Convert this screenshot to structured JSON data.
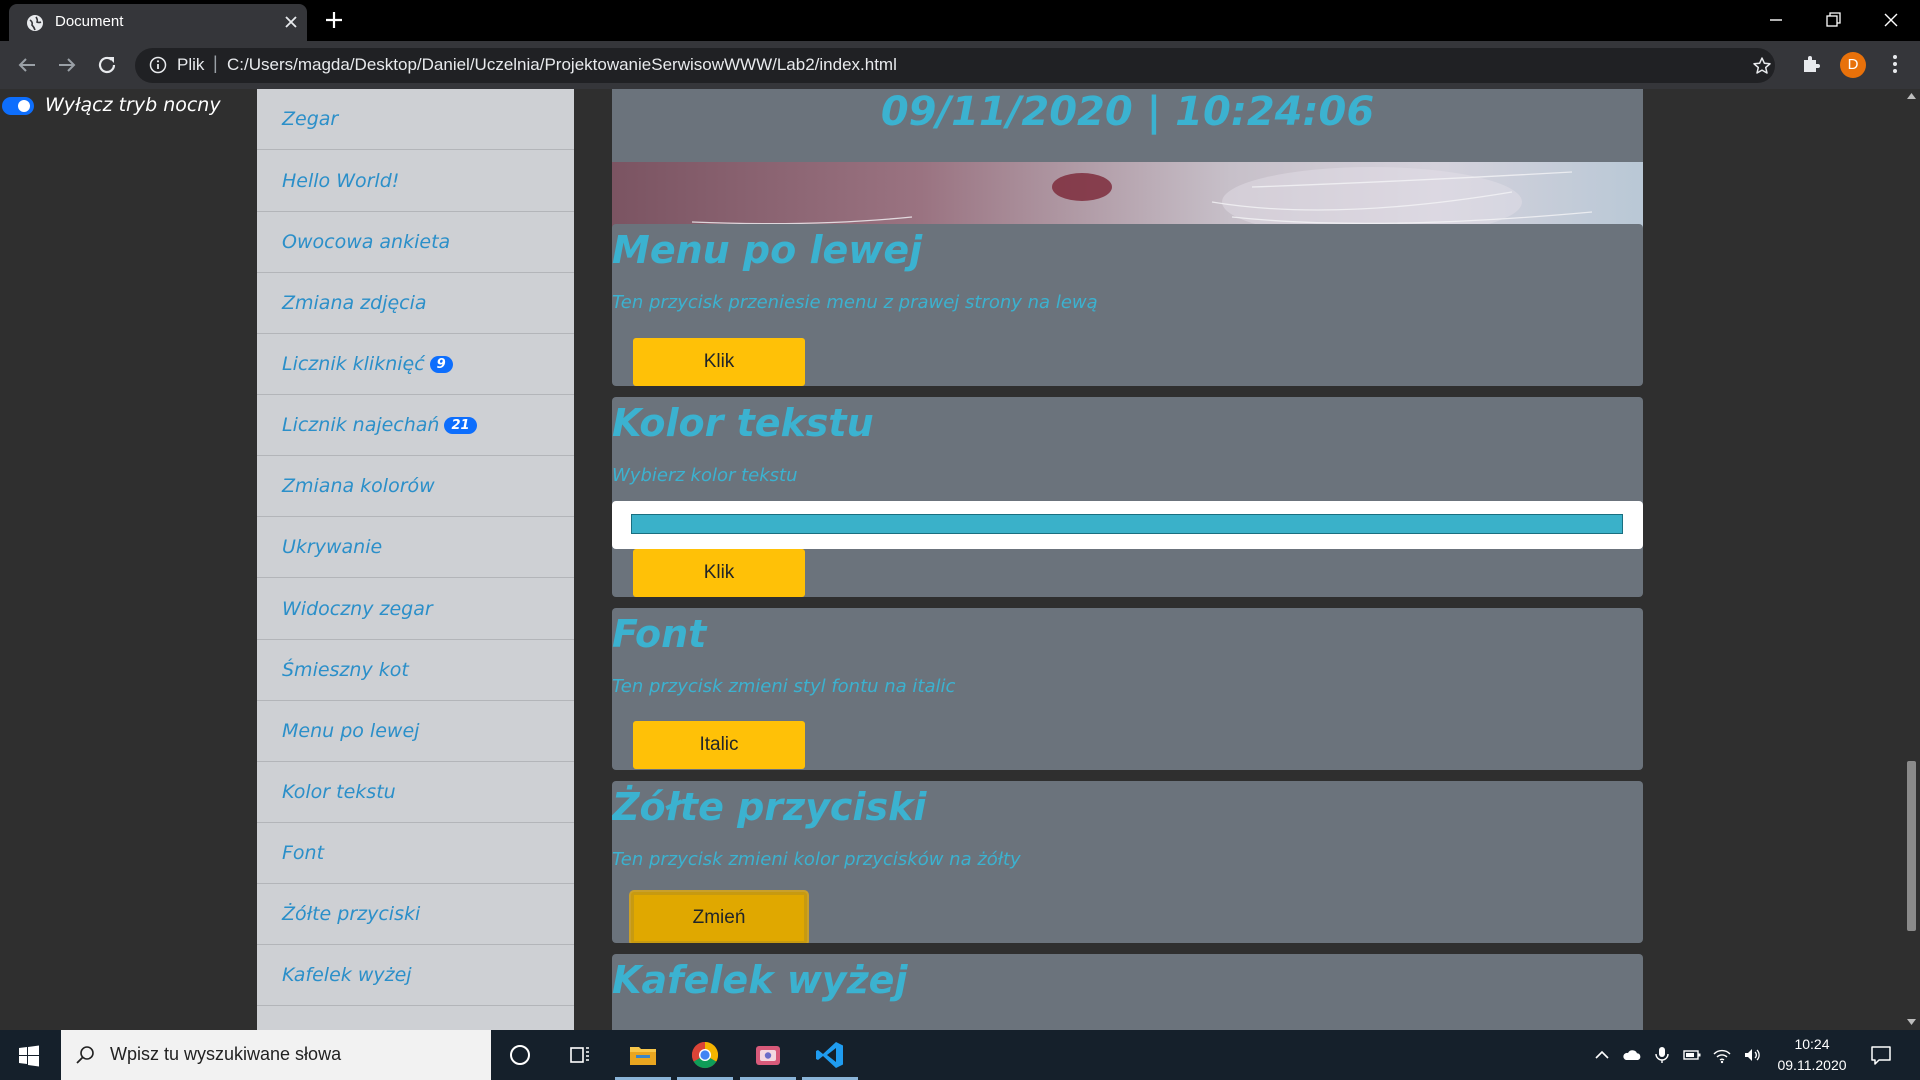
{
  "browser": {
    "tab_title": "Document",
    "omnibox_prefix": "Plik",
    "omnibox_separator": "|",
    "url": "C:/Users/magda/Desktop/Daniel/Uczelnia/ProjektowanieSerwisowWWW/Lab2/index.html",
    "profile_initial": "D"
  },
  "night_switch": {
    "label": "Wyłącz tryb nocny",
    "checked": true
  },
  "sidebar": {
    "items": [
      {
        "label": "Zegar"
      },
      {
        "label": "Hello World!"
      },
      {
        "label": "Owocowa ankieta"
      },
      {
        "label": "Zmiana zdjęcia"
      },
      {
        "label": "Licznik kliknięć",
        "badge": "9"
      },
      {
        "label": "Licznik najechań",
        "badge": "21"
      },
      {
        "label": "Zmiana kolorów"
      },
      {
        "label": "Ukrywanie"
      },
      {
        "label": "Widoczny zegar"
      },
      {
        "label": "Śmieszny kot"
      },
      {
        "label": "Menu po lewej"
      },
      {
        "label": "Kolor tekstu"
      },
      {
        "label": "Font"
      },
      {
        "label": "Żółte przyciski"
      },
      {
        "label": "Kafelek wyżej"
      }
    ]
  },
  "clock": {
    "text": "09/11/2020 | 10:24:06"
  },
  "cards": {
    "menu_left": {
      "title": "Menu po lewej",
      "desc": "Ten przycisk przeniesie menu z prawej strony na lewą",
      "button": "Klik"
    },
    "text_color": {
      "title": "Kolor tekstu",
      "desc": "Wybierz kolor tekstu",
      "value": "#3ab1c9",
      "button": "Klik"
    },
    "font": {
      "title": "Font",
      "desc": "Ten przycisk zmieni styl fontu na italic",
      "button": "Italic"
    },
    "yellow_buttons": {
      "title": "Żółte przyciski",
      "desc": "Ten przycisk zmieni kolor przycisków na żółty",
      "button": "Zmień"
    },
    "tile_up": {
      "title": "Kafelek wyżej"
    }
  },
  "taskbar": {
    "search_placeholder": "Wpisz tu wyszukiwane słowa",
    "time": "10:24",
    "date": "09.11.2020"
  },
  "colors": {
    "accent_text": "#3bb2d0",
    "card_bg": "#6b737c",
    "sidebar_bg": "#ced0d4",
    "button_yellow": "#ffc107",
    "badge_blue": "#0d6efd"
  },
  "icons": {
    "tab_favicon": "globe-icon",
    "tab_close": "close-icon",
    "new_tab": "plus-icon",
    "back": "arrow-left-icon",
    "forward": "arrow-right-icon",
    "reload": "reload-icon",
    "site_info": "info-icon",
    "bookmark": "star-icon",
    "extensions": "puzzle-icon",
    "menu": "more-vert-icon"
  }
}
